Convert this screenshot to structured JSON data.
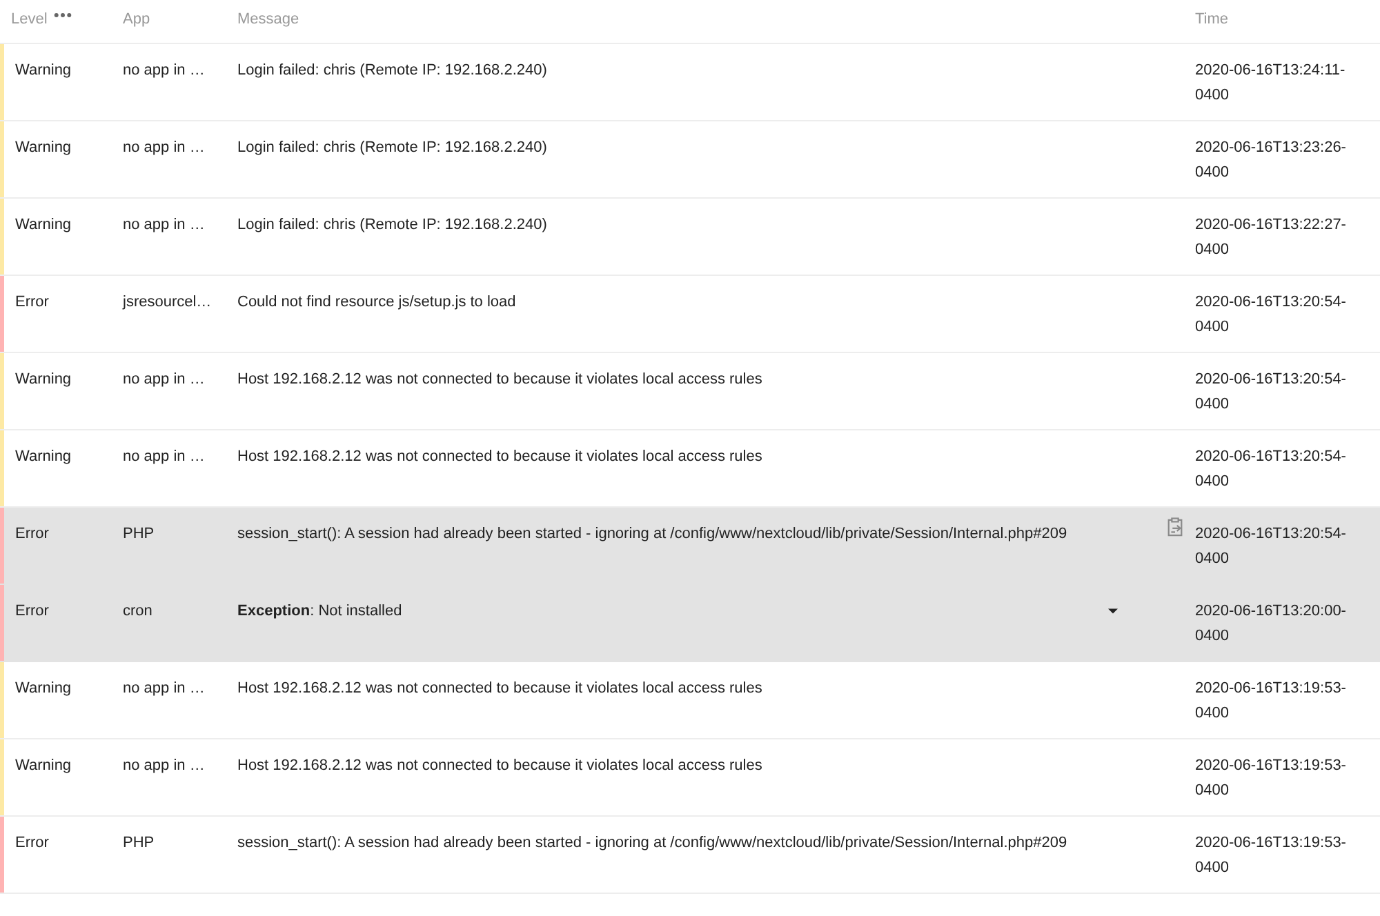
{
  "table": {
    "columns": [
      "Level",
      "App",
      "Message",
      "Time"
    ],
    "rows": [
      {
        "level": "Warning",
        "color": "#fde9a4",
        "app": "no app in …",
        "message": "Login failed: chris (Remote IP: 192.168.2.240)",
        "time": "2020-06-16T13:24:11-0400",
        "highlighted": false,
        "expandable": false,
        "copy_button": false
      },
      {
        "level": "Warning",
        "color": "#fde9a4",
        "app": "no app in …",
        "message": "Login failed: chris (Remote IP: 192.168.2.240)",
        "time": "2020-06-16T13:23:26-0400",
        "highlighted": false,
        "expandable": false,
        "copy_button": false
      },
      {
        "level": "Warning",
        "color": "#fde9a4",
        "app": "no app in …",
        "message": "Login failed: chris (Remote IP: 192.168.2.240)",
        "time": "2020-06-16T13:22:27-0400",
        "highlighted": false,
        "expandable": false,
        "copy_button": false
      },
      {
        "level": "Error",
        "color": "#ffb3b3",
        "app": "jsresourcel…",
        "message": "Could not find resource js/setup.js to load",
        "time": "2020-06-16T13:20:54-0400",
        "highlighted": false,
        "expandable": false,
        "copy_button": false
      },
      {
        "level": "Warning",
        "color": "#fde9a4",
        "app": "no app in …",
        "message": "Host 192.168.2.12 was not connected to because it violates local access rules",
        "time": "2020-06-16T13:20:54-0400",
        "highlighted": false,
        "expandable": false,
        "copy_button": false
      },
      {
        "level": "Warning",
        "color": "#fde9a4",
        "app": "no app in …",
        "message": "Host 192.168.2.12 was not connected to because it violates local access rules",
        "time": "2020-06-16T13:20:54-0400",
        "highlighted": false,
        "expandable": false,
        "copy_button": false
      },
      {
        "level": "Error",
        "color": "#ffb3b3",
        "app": "PHP",
        "message": "session_start(): A session had already been started - ignoring at /config/www/nextcloud/lib/private/Session/Internal.php#209",
        "time": "2020-06-16T13:20:54-0400",
        "highlighted": true,
        "expandable": false,
        "copy_button": true
      },
      {
        "level": "Error",
        "color": "#ffb3b3",
        "app": "cron",
        "message": "**Exception**: Not installed",
        "time": "2020-06-16T13:20:00-0400",
        "highlighted": true,
        "expandable": true,
        "copy_button": false
      },
      {
        "level": "Warning",
        "color": "#fde9a4",
        "app": "no app in …",
        "message": "Host 192.168.2.12 was not connected to because it violates local access rules",
        "time": "2020-06-16T13:19:53-0400",
        "highlighted": false,
        "expandable": false,
        "copy_button": false
      },
      {
        "level": "Warning",
        "color": "#fde9a4",
        "app": "no app in …",
        "message": "Host 192.168.2.12 was not connected to because it violates local access rules",
        "time": "2020-06-16T13:19:53-0400",
        "highlighted": false,
        "expandable": false,
        "copy_button": false
      },
      {
        "level": "Error",
        "color": "#ffb3b3",
        "app": "PHP",
        "message": "session_start(): A session had already been started - ignoring at /config/www/nextcloud/lib/private/Session/Internal.php#209",
        "time": "2020-06-16T13:19:53-0400",
        "highlighted": false,
        "expandable": false,
        "copy_button": false
      }
    ]
  }
}
